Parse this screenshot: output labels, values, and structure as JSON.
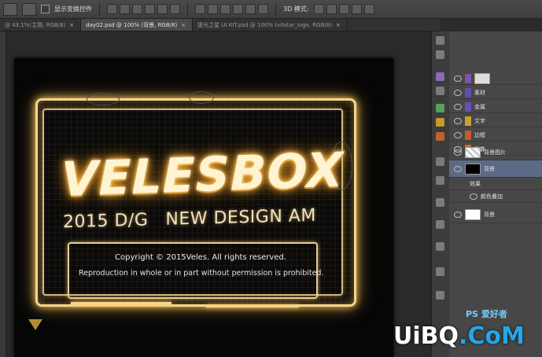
{
  "optionsbar": {
    "show_transform_label": "显示变换控件",
    "mode3d_label": "3D 模式:"
  },
  "tabs": [
    {
      "label": "@ 43.1%(主题, RGB/8)",
      "active": false
    },
    {
      "label": "day02.psd @ 100% (背景, RGB/8)",
      "active": true
    },
    {
      "label": "提光之星 UI KIT.psd @ 100% (vitstar_logo, RGB/8)",
      "active": false
    }
  ],
  "tab_close_glyph": "×",
  "canvas": {
    "brand": "VELESBOX",
    "tagline_left": "2015 D/G",
    "tagline_right": "NEW DESIGN AM",
    "copyright": "Copyright © 2015Veles. All rights reserved.",
    "reproduction": "Reproduction in whole or in part without permission is prohibited."
  },
  "layers": [
    {
      "name": "",
      "swatch": "#7a56a8",
      "selected": false
    },
    {
      "name": "素材",
      "swatch": "#5f4db0",
      "selected": false
    },
    {
      "name": "金属",
      "swatch": "#6a4fb4",
      "selected": false
    },
    {
      "name": "文字",
      "swatch": "#c7a233",
      "selected": false
    },
    {
      "name": "边框",
      "swatch": "#c45a2c",
      "selected": false
    },
    {
      "name": "装饰",
      "swatch": "#c86a2a",
      "selected": false
    },
    {
      "name": "背景图片",
      "swatch": "",
      "selected": false
    },
    {
      "name": "背景",
      "swatch": "",
      "selected": true
    },
    {
      "name": "效果",
      "swatch": "",
      "selected": false
    },
    {
      "name": "颜色叠加",
      "swatch": "",
      "selected": false
    },
    {
      "name": "背景",
      "swatch": "",
      "selected": false
    }
  ],
  "watermark": {
    "site_a": "UiBQ",
    "site_b": ".CoM",
    "ps_label": "PS 爱好者"
  },
  "colors": {
    "neon": "#f6d58a",
    "layer_selected": "#5d6a86",
    "watermark_accent": "#26a6e6"
  }
}
